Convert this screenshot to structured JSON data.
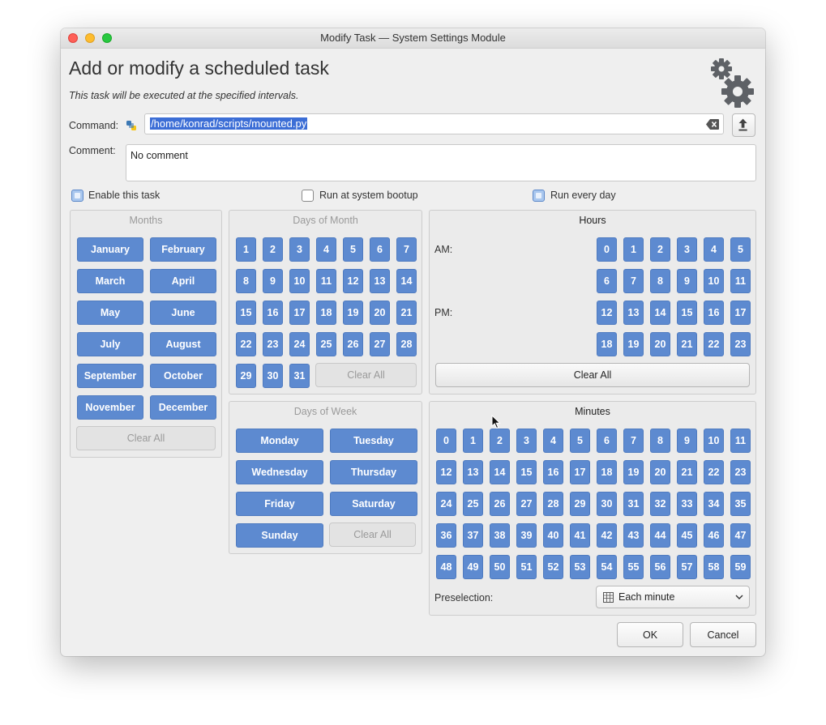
{
  "window": {
    "title": "Modify Task — System Settings Module"
  },
  "heading": "Add or modify a scheduled task",
  "subheading": "This task will be executed at the specified intervals.",
  "command": {
    "label": "Command:",
    "value": "/home/konrad/scripts/mounted.py"
  },
  "comment": {
    "label": "Comment:",
    "value": "No comment"
  },
  "options": {
    "enable": {
      "label": "Enable this task",
      "checked": true
    },
    "bootup": {
      "label": "Run at system bootup",
      "checked": false
    },
    "everyday": {
      "label": "Run every day",
      "checked": true
    }
  },
  "months": {
    "title": "Months",
    "items": [
      "January",
      "February",
      "March",
      "April",
      "May",
      "June",
      "July",
      "August",
      "September",
      "October",
      "November",
      "December"
    ],
    "clear": "Clear All"
  },
  "days_of_month": {
    "title": "Days of Month",
    "items": [
      "1",
      "2",
      "3",
      "4",
      "5",
      "6",
      "7",
      "8",
      "9",
      "10",
      "11",
      "12",
      "13",
      "14",
      "15",
      "16",
      "17",
      "18",
      "19",
      "20",
      "21",
      "22",
      "23",
      "24",
      "25",
      "26",
      "27",
      "28",
      "29",
      "30",
      "31"
    ],
    "clear": "Clear All"
  },
  "days_of_week": {
    "title": "Days of Week",
    "items": [
      "Monday",
      "Tuesday",
      "Wednesday",
      "Thursday",
      "Friday",
      "Saturday",
      "Sunday"
    ],
    "clear": "Clear All"
  },
  "hours": {
    "title": "Hours",
    "am_label": "AM:",
    "pm_label": "PM:",
    "items": [
      "0",
      "1",
      "2",
      "3",
      "4",
      "5",
      "6",
      "7",
      "8",
      "9",
      "10",
      "11",
      "12",
      "13",
      "14",
      "15",
      "16",
      "17",
      "18",
      "19",
      "20",
      "21",
      "22",
      "23"
    ],
    "clear": "Clear All"
  },
  "minutes": {
    "title": "Minutes",
    "items": [
      "0",
      "1",
      "2",
      "3",
      "4",
      "5",
      "6",
      "7",
      "8",
      "9",
      "10",
      "11",
      "12",
      "13",
      "14",
      "15",
      "16",
      "17",
      "18",
      "19",
      "20",
      "21",
      "22",
      "23",
      "24",
      "25",
      "26",
      "27",
      "28",
      "29",
      "30",
      "31",
      "32",
      "33",
      "34",
      "35",
      "36",
      "37",
      "38",
      "39",
      "40",
      "41",
      "42",
      "43",
      "44",
      "45",
      "46",
      "47",
      "48",
      "49",
      "50",
      "51",
      "52",
      "53",
      "54",
      "55",
      "56",
      "57",
      "58",
      "59"
    ],
    "preselection_label": "Preselection:",
    "preselection_value": "Each minute"
  },
  "buttons": {
    "ok": "OK",
    "cancel": "Cancel"
  },
  "icons": {
    "settings": "gears-icon",
    "python": "python-file-icon",
    "clear": "clear-text-icon",
    "upload": "upload-icon",
    "calendar": "calendar-grid-icon",
    "dropdown": "chevron-down-icon"
  },
  "colors": {
    "accent": "#5d8ad0",
    "selection": "#3c6ed6"
  }
}
